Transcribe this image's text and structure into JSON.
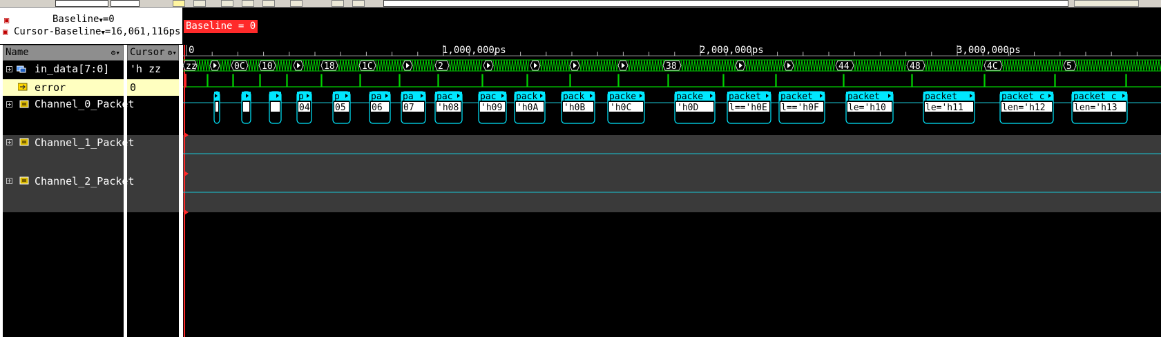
{
  "toolbar": {
    "label": "waveform toolbar"
  },
  "baseline": {
    "baseline_text": "Baseline",
    "baseline_value": "=0",
    "cursor_baseline_text": "Cursor-Baseline",
    "cursor_baseline_value": "=16,061,116ps",
    "marker_label": "Baseline = 0"
  },
  "columns": {
    "name_header": "Name",
    "cursor_header": "Cursor"
  },
  "signals": [
    {
      "name": "in_data[7:0]",
      "cursor_value": "'h zz",
      "kind": "bus"
    },
    {
      "name": "error",
      "cursor_value": "0",
      "kind": "bit"
    },
    {
      "name": "Channel_0_Packet",
      "cursor_value": "",
      "kind": "transaction"
    },
    {
      "name": "Channel_1_Packet",
      "cursor_value": "",
      "kind": "transaction"
    },
    {
      "name": "Channel_2_Packet",
      "cursor_value": "",
      "kind": "transaction"
    }
  ],
  "ruler": {
    "labels": [
      "0",
      "1,000,000ps",
      "2,000,000ps",
      "3,000,000ps"
    ]
  },
  "bus_values": [
    "zz",
    "0C",
    "10",
    "18",
    "1C",
    "2",
    "38",
    "44",
    "48",
    "4C",
    "5"
  ],
  "packets": [
    {
      "head": "",
      "val": ""
    },
    {
      "head": "",
      "val": ""
    },
    {
      "head": "",
      "val": ""
    },
    {
      "head": "p",
      "val": "04"
    },
    {
      "head": "p",
      "val": "05"
    },
    {
      "head": "pa",
      "val": "06"
    },
    {
      "head": "pa",
      "val": "07"
    },
    {
      "head": "pac",
      "val": "'h08"
    },
    {
      "head": "pac",
      "val": "'h09"
    },
    {
      "head": "pack",
      "val": "'h0A"
    },
    {
      "head": "pack",
      "val": "'h0B"
    },
    {
      "head": "packe",
      "val": "'h0C"
    },
    {
      "head": "packe",
      "val": "'h0D"
    },
    {
      "head": "packet",
      "val": "l=='h0E"
    },
    {
      "head": "packet",
      "val": "l=='h0F"
    },
    {
      "head": "packet_",
      "val": "le='h10"
    },
    {
      "head": "packet_",
      "val": "le='h11"
    },
    {
      "head": "packet_c",
      "val": "len='h12"
    },
    {
      "head": "packet_c",
      "val": "len='h13"
    }
  ],
  "colors": {
    "wave_green": "#00d000",
    "packet_cyan": "#00e8ff",
    "baseline_red": "#ff2a2a",
    "selected_row": "#ffffc0"
  }
}
